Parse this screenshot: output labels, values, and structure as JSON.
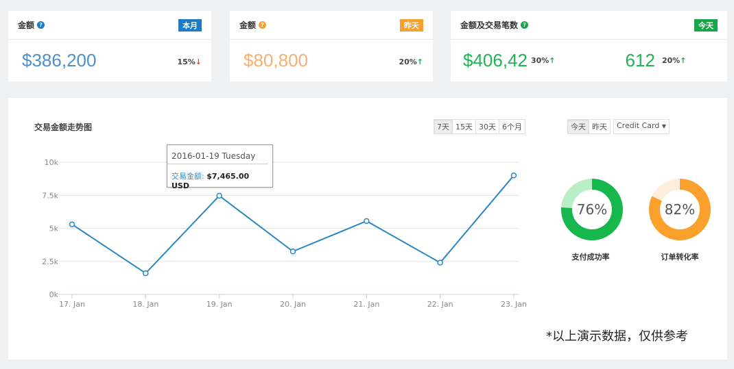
{
  "cards": [
    {
      "title": "金额",
      "badge": "本月",
      "badge_color": "#1e7bc4",
      "help_color": "#1e7bc4",
      "value": "$386,200",
      "value_color": "#4e8fcb",
      "pct": "15%",
      "arrow": "↓",
      "arrow_color": "#e84c3d"
    },
    {
      "title": "金额",
      "badge": "昨天",
      "badge_color": "#f5a030",
      "help_color": "#f5a030",
      "value": "$80,800",
      "value_color": "#f6b072",
      "pct": "20%",
      "arrow": "↑",
      "arrow_color": "#1aab4c"
    },
    {
      "title": "金额及交易笔数",
      "badge": "今天",
      "badge_color": "#19a64b",
      "help_color": "#19a64b",
      "value": "$406,42",
      "value_color": "#21b257",
      "pct": "30%",
      "arrow": "↑",
      "arrow_color": "#1aab4c",
      "value2": "612",
      "pct2": "20%"
    }
  ],
  "chart": {
    "title": "交易金额走势图",
    "range_buttons": [
      "7天",
      "15天",
      "30天",
      "6个月"
    ],
    "tooltip": {
      "date": "2016-01-19 Tuesday",
      "label": "交易金额:",
      "value": "$7,465.00 USD"
    }
  },
  "donut_controls": {
    "buttons": [
      "今天",
      "昨天"
    ],
    "dropdown": "Credit Card"
  },
  "donuts": [
    {
      "label": "支付成功率",
      "value": 76,
      "text": "76%",
      "color": "#16b84d",
      "track": "#b8efc9"
    },
    {
      "label": "订单转化率",
      "value": 82,
      "text": "82%",
      "color": "#f9a12c",
      "track": "#fdeedb"
    }
  ],
  "note": "*以上演示数据，仅供参考",
  "chart_data": {
    "type": "line",
    "categories": [
      "17. Jan",
      "18. Jan",
      "19. Jan",
      "20. Jan",
      "21. Jan",
      "22. Jan",
      "23. Jan"
    ],
    "y_ticks": [
      "0k",
      "2.5k",
      "5k",
      "7.5k",
      "10k"
    ],
    "ylim": [
      0,
      10000
    ],
    "series": [
      {
        "values": [
          5300,
          1600,
          7465,
          3250,
          5550,
          2400,
          9000
        ]
      }
    ],
    "color": "#2a86c2",
    "grid": true
  }
}
